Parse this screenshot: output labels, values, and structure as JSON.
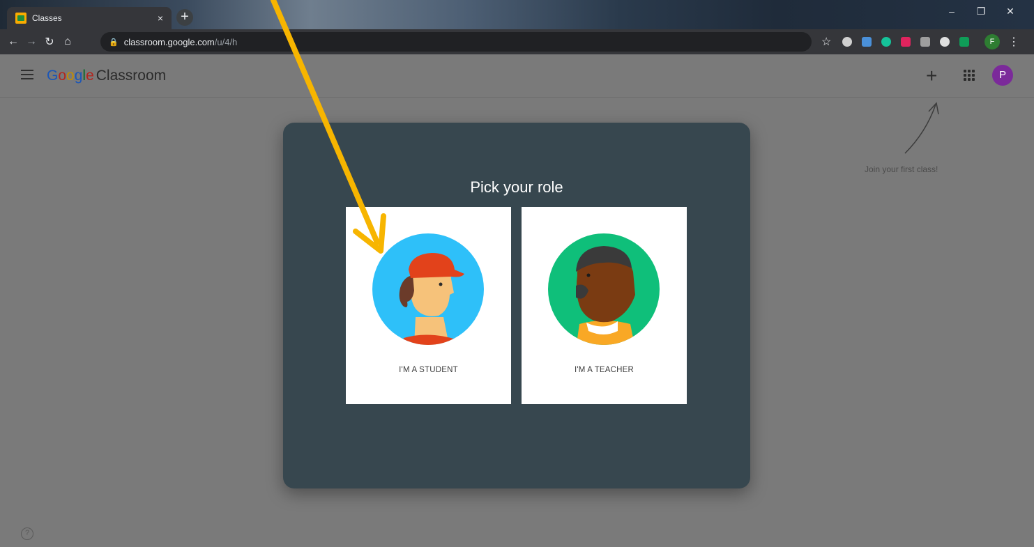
{
  "browser": {
    "tab_title": "Classes",
    "tab_close": "×",
    "new_tab": "+",
    "url_host": "classroom.google.com",
    "url_path": "/u/4/h",
    "profile_initial": "F"
  },
  "app": {
    "brand_letters": [
      "G",
      "o",
      "o",
      "g",
      "l",
      "e"
    ],
    "product": "Classroom",
    "add_button": "+",
    "avatar_initial": "P",
    "join_hint": "Join your first class!"
  },
  "dialog": {
    "title": "Pick your role",
    "roles": [
      {
        "label": "I'M A STUDENT"
      },
      {
        "label": "I'M A TEACHER"
      }
    ]
  },
  "footer": {
    "help": "?"
  },
  "colors": {
    "dialog_bg": "#37474f",
    "annotation_arrow": "#f7b500",
    "student_circle": "#2ec0f9",
    "teacher_circle": "#0fbf7a"
  },
  "icons": [
    "menu-icon",
    "apps-icon",
    "help-icon",
    "lock-icon",
    "star-icon"
  ]
}
